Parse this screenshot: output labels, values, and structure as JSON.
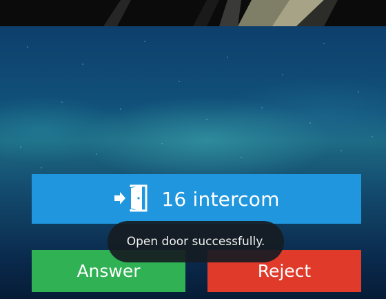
{
  "call": {
    "intercom_label": "16 intercom",
    "door_icon": "door-open-icon"
  },
  "actions": {
    "answer_label": "Answer",
    "reject_label": "Reject"
  },
  "toast": {
    "message": "Open door successfully."
  },
  "colors": {
    "banner": "#1f96de",
    "answer": "#2fb154",
    "reject": "#e03a2a",
    "toast_bg": "#161c22"
  }
}
